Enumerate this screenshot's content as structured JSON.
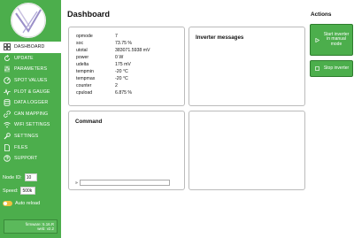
{
  "sidebar": {
    "items": [
      {
        "label": "DASHBOARD",
        "icon": "grid-icon"
      },
      {
        "label": "UPDATE",
        "icon": "refresh-icon"
      },
      {
        "label": "PARAMETERS",
        "icon": "sliders-icon"
      },
      {
        "label": "SPOT VALUES",
        "icon": "gauge-icon"
      },
      {
        "label": "PLOT & GAUGE",
        "icon": "pulse-icon"
      },
      {
        "label": "DATA LOGGER",
        "icon": "database-icon"
      },
      {
        "label": "CAN MAPPING",
        "icon": "link-icon"
      },
      {
        "label": "WIFI SETTINGS",
        "icon": "wifi-icon"
      },
      {
        "label": "SETTINGS",
        "icon": "wrench-icon"
      },
      {
        "label": "FILES",
        "icon": "file-icon"
      },
      {
        "label": "SUPPORT",
        "icon": "help-icon"
      }
    ],
    "node_id_label": "Node ID:",
    "node_id_value": "10",
    "speed_label": "Speed:",
    "speed_value": "500k",
    "auto_reload_label": "Auto reload",
    "version": {
      "firmware": "firmware: 5.16.R",
      "web": "web: v2.2"
    }
  },
  "main": {
    "title": "Dashboard",
    "params": [
      {
        "key": "opmode",
        "value": "7"
      },
      {
        "key": "soc",
        "value": "73.75 %"
      },
      {
        "key": "utotal",
        "value": "383071.5938 mV"
      },
      {
        "key": "power",
        "value": "0 W"
      },
      {
        "key": "udelta",
        "value": "175 mV"
      },
      {
        "key": "tempmin",
        "value": "-20 °C"
      },
      {
        "key": "tempmax",
        "value": "-20 °C"
      },
      {
        "key": "counter",
        "value": "2"
      },
      {
        "key": "cpuload",
        "value": "6.875 %"
      }
    ],
    "inverter_messages_title": "Inverter messages",
    "command_title": "Command",
    "command_prompt": "»",
    "command_value": ""
  },
  "actions": {
    "title": "Actions",
    "start_label": "Start inverter in manual mode",
    "stop_label": "Stop inverter"
  },
  "colors": {
    "sidebar": "#4cae4c",
    "toggle": "#f0c040"
  }
}
